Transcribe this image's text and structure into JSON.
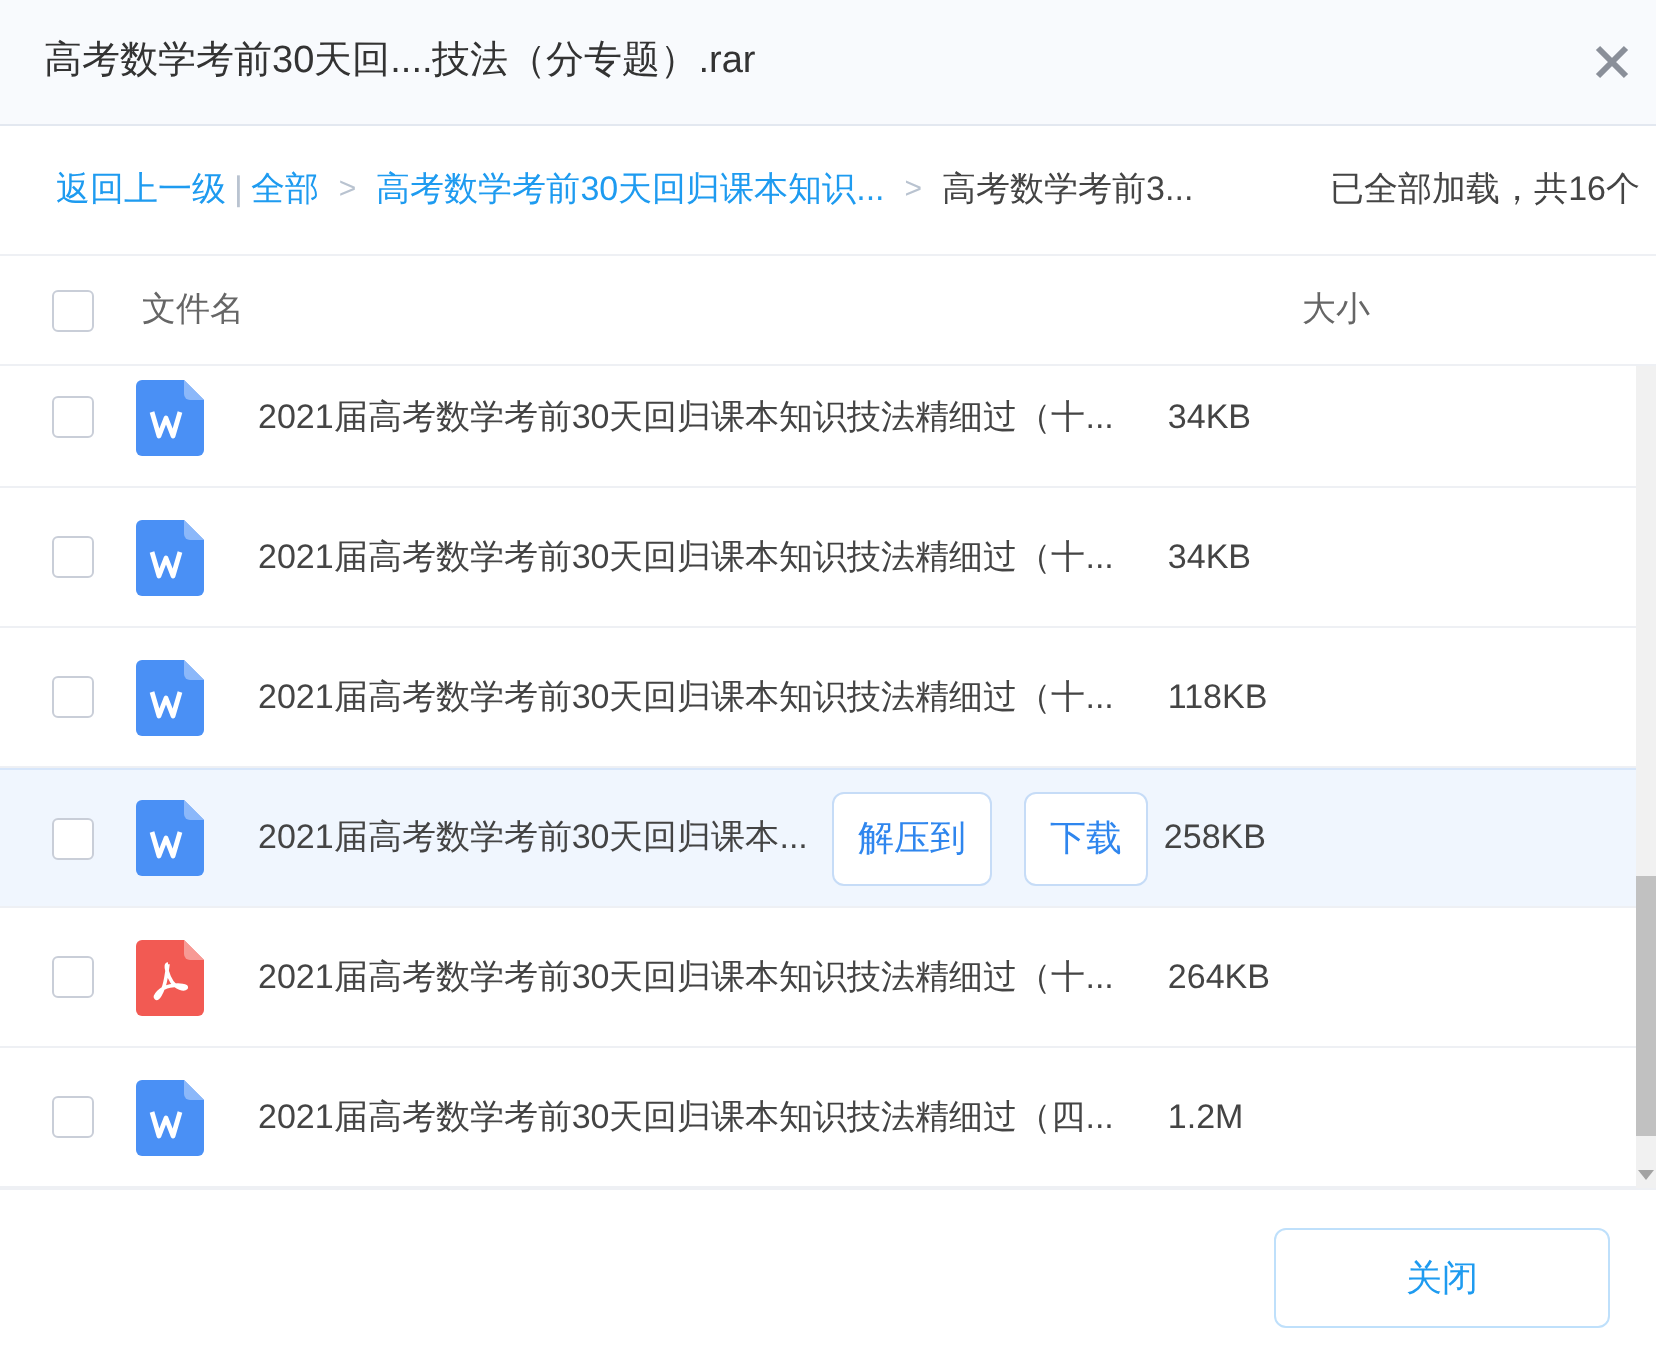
{
  "window": {
    "title": "高考数学考前30天回....技法（分专题）.rar"
  },
  "breadcrumb": {
    "back": "返回上一级",
    "separator": "|",
    "items": [
      {
        "label": "全部",
        "current": false
      },
      {
        "label": "高考数学考前30天回归课本知识...",
        "current": false
      },
      {
        "label": "高考数学考前3...",
        "current": true
      }
    ],
    "arrow": ">",
    "status": "已全部加载，共16个"
  },
  "table": {
    "columns": [
      "文件名",
      "大小"
    ],
    "all_checked": false,
    "rows": [
      {
        "kind": "word",
        "name": "2021届高考数学考前30天回归课本知识技法精细过（十...",
        "size": "34KB",
        "checked": false,
        "hovered": false
      },
      {
        "kind": "word",
        "name": "2021届高考数学考前30天回归课本知识技法精细过（十...",
        "size": "34KB",
        "checked": false,
        "hovered": false
      },
      {
        "kind": "word",
        "name": "2021届高考数学考前30天回归课本知识技法精细过（十...",
        "size": "118KB",
        "checked": false,
        "hovered": false
      },
      {
        "kind": "word",
        "name": "2021届高考数学考前30天回归课本...",
        "size": "258KB",
        "checked": false,
        "hovered": true
      },
      {
        "kind": "pdf",
        "name": "2021届高考数学考前30天回归课本知识技法精细过（十...",
        "size": "264KB",
        "checked": false,
        "hovered": false
      },
      {
        "kind": "word",
        "name": "2021届高考数学考前30天回归课本知识技法精细过（四...",
        "size": "1.2M",
        "checked": false,
        "hovered": false
      }
    ],
    "row_actions": [
      "解压到",
      "下载"
    ]
  },
  "footer": {
    "button": "关闭"
  }
}
